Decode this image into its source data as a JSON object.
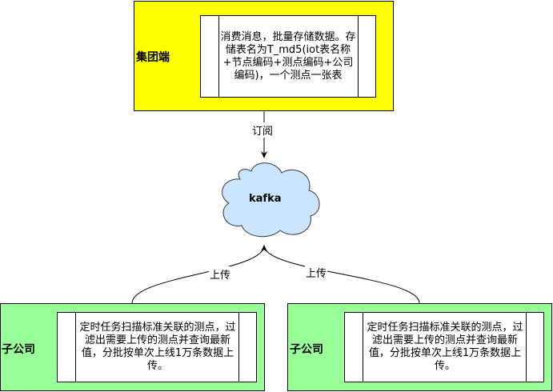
{
  "group_node": {
    "label": "集团端",
    "description": "消费消息，批量存储数据。存储表名为T_md5(iot表名称+节点编码+测点编码+公司编码)，一个测点一张表",
    "fill": "#ffff00"
  },
  "kafka_node": {
    "label": "kafka",
    "fill": "#cce5ff"
  },
  "subsidiaries": [
    {
      "label": "子公司",
      "description": "定时任务扫描标准关联的测点，过滤出需要上传的测点并查询最新值，分批按单次上线1万条数据上传。",
      "fill": "#99ff99"
    },
    {
      "label": "子公司",
      "description": "定时任务扫描标准关联的测点，过滤出需要上传的测点并查询最新值，分批按单次上线1万条数据上传。",
      "fill": "#99ff99"
    }
  ],
  "edges": {
    "subscribe_label": "订阅",
    "upload_left_label": "上传",
    "upload_right_label": "上传"
  }
}
